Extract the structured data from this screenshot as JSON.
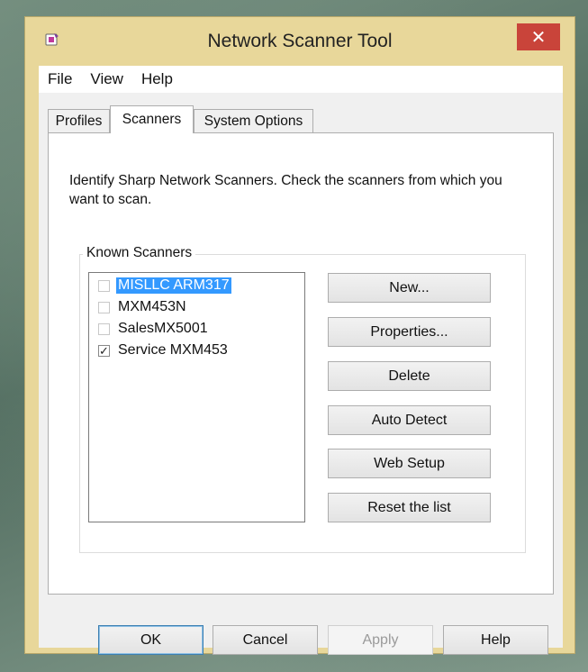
{
  "window": {
    "title": "Network Scanner Tool",
    "close_glyph": "✕",
    "accent": "#e8d79a",
    "close_color": "#c9443a"
  },
  "menu": [
    "File",
    "View",
    "Help"
  ],
  "tabs": [
    {
      "label": "Profiles",
      "active": false
    },
    {
      "label": "Scanners",
      "active": true
    },
    {
      "label": "System Options",
      "active": false
    }
  ],
  "scanners_tab": {
    "description": "Identify Sharp Network Scanners. Check the scanners from which you want to scan.",
    "group_label": "Known Scanners",
    "items": [
      {
        "label": "MISLLC ARM317",
        "checked": false,
        "selected": true
      },
      {
        "label": "MXM453N",
        "checked": false,
        "selected": false
      },
      {
        "label": "SalesMX5001",
        "checked": false,
        "selected": false
      },
      {
        "label": "Service MXM453",
        "checked": true,
        "selected": false
      }
    ],
    "buttons": [
      "New...",
      "Properties...",
      "Delete",
      "Auto Detect",
      "Web Setup",
      "Reset the list"
    ]
  },
  "footer": {
    "ok": "OK",
    "cancel": "Cancel",
    "apply": "Apply",
    "help": "Help"
  },
  "icons": {
    "app": "scanner-app-icon",
    "check": "✓"
  }
}
